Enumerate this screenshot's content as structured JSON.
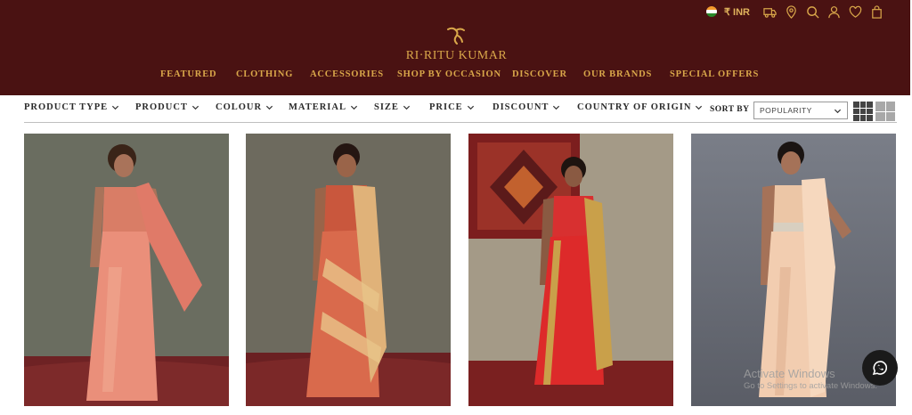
{
  "brand": {
    "name": "RI·RITU KUMAR",
    "gold": "#d9a74a",
    "header_bg": "#4a1212"
  },
  "utility": {
    "currency": "₹ INR",
    "icons": [
      "india-flag-icon",
      "delivery-truck-icon",
      "location-pin-icon",
      "search-icon",
      "user-icon",
      "heart-icon",
      "shopping-bag-icon"
    ]
  },
  "nav": [
    {
      "label": "FEATURED"
    },
    {
      "label": "CLOTHING"
    },
    {
      "label": "ACCESSORIES"
    },
    {
      "label": "SHOP BY OCCASION"
    },
    {
      "label": "DISCOVER"
    },
    {
      "label": "OUR BRANDS"
    },
    {
      "label": "SPECIAL OFFERS"
    }
  ],
  "filters": [
    {
      "label": "PRODUCT TYPE"
    },
    {
      "label": "PRODUCT"
    },
    {
      "label": "COLOUR"
    },
    {
      "label": "MATERIAL"
    },
    {
      "label": "SIZE"
    },
    {
      "label": "PRICE"
    },
    {
      "label": "DISCOUNT"
    },
    {
      "label": "COUNTRY OF ORIGIN"
    }
  ],
  "sort": {
    "label": "SORT BY",
    "selected": "POPULARITY"
  },
  "products": [
    {
      "alt": "coral floral saree",
      "color": "#e88370"
    },
    {
      "alt": "red printed saree",
      "color": "#d65a3e"
    },
    {
      "alt": "red checked saree with gold border",
      "color": "#d92b2b"
    },
    {
      "alt": "peach ruffle saree",
      "color": "#f2c9a8"
    }
  ],
  "overlay": {
    "line1": "Activate Windows",
    "line2": "Go to Settings to activate Windows."
  }
}
